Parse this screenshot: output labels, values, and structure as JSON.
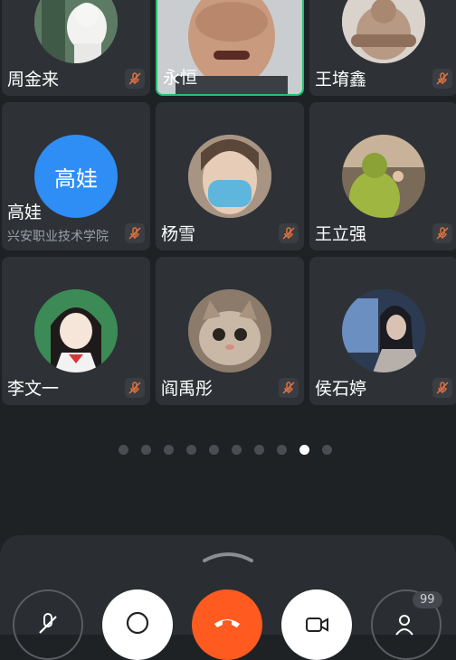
{
  "participants": [
    {
      "name": "周金来",
      "muted": true
    },
    {
      "name": "永恒",
      "muted": false,
      "speaking": true
    },
    {
      "name": "王堉鑫",
      "muted": true
    },
    {
      "name": "高娃",
      "avatar_text": "高娃",
      "subtitle": "兴安职业技术学院",
      "muted": true
    },
    {
      "name": "杨雪",
      "muted": true
    },
    {
      "name": "王立强",
      "muted": true
    },
    {
      "name": "李文一",
      "muted": true
    },
    {
      "name": "阎禹彤",
      "muted": true
    },
    {
      "name": "侯石婷",
      "muted": true
    }
  ],
  "pagination": {
    "total_pages": 10,
    "current_page": 9
  },
  "toolbar": {
    "participants_count": "99"
  },
  "colors": {
    "accent": "#1fc46f",
    "end_call": "#ff5a1f",
    "avatar_blue": "#2f8df6"
  }
}
